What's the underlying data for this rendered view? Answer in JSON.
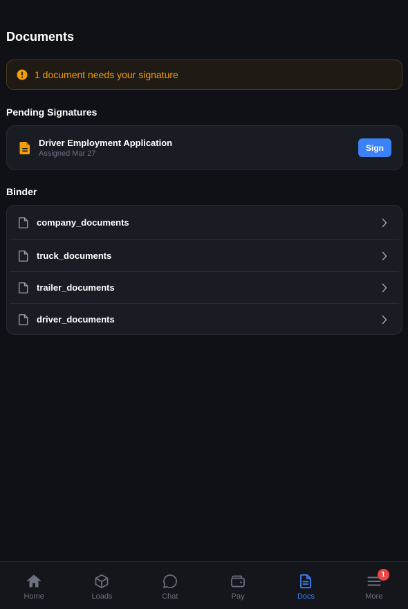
{
  "page": {
    "title": "Documents"
  },
  "alert": {
    "text": "1 document needs your signature",
    "icon": "alert-circle-icon",
    "color": "#f59e0b"
  },
  "pending": {
    "section_title": "Pending Signatures",
    "items": [
      {
        "title": "Driver Employment Application",
        "subtitle": "Assigned Mar 27",
        "action_label": "Sign",
        "icon": "document-text-icon"
      }
    ]
  },
  "binder": {
    "section_title": "Binder",
    "items": [
      {
        "label": "company_documents",
        "icon": "file-icon"
      },
      {
        "label": "truck_documents",
        "icon": "file-icon"
      },
      {
        "label": "trailer_documents",
        "icon": "file-icon"
      },
      {
        "label": "driver_documents",
        "icon": "file-icon"
      }
    ]
  },
  "nav": {
    "items": [
      {
        "label": "Home",
        "icon": "home-icon"
      },
      {
        "label": "Loads",
        "icon": "box-icon"
      },
      {
        "label": "Chat",
        "icon": "chat-bubble-icon"
      },
      {
        "label": "Pay",
        "icon": "wallet-icon"
      },
      {
        "label": "Docs",
        "icon": "document-icon",
        "active": true
      },
      {
        "label": "More",
        "icon": "menu-icon",
        "badge": "1"
      }
    ]
  },
  "colors": {
    "accent": "#3b82f6",
    "warning": "#f59e0b",
    "danger": "#ef4444",
    "background": "#101116"
  }
}
